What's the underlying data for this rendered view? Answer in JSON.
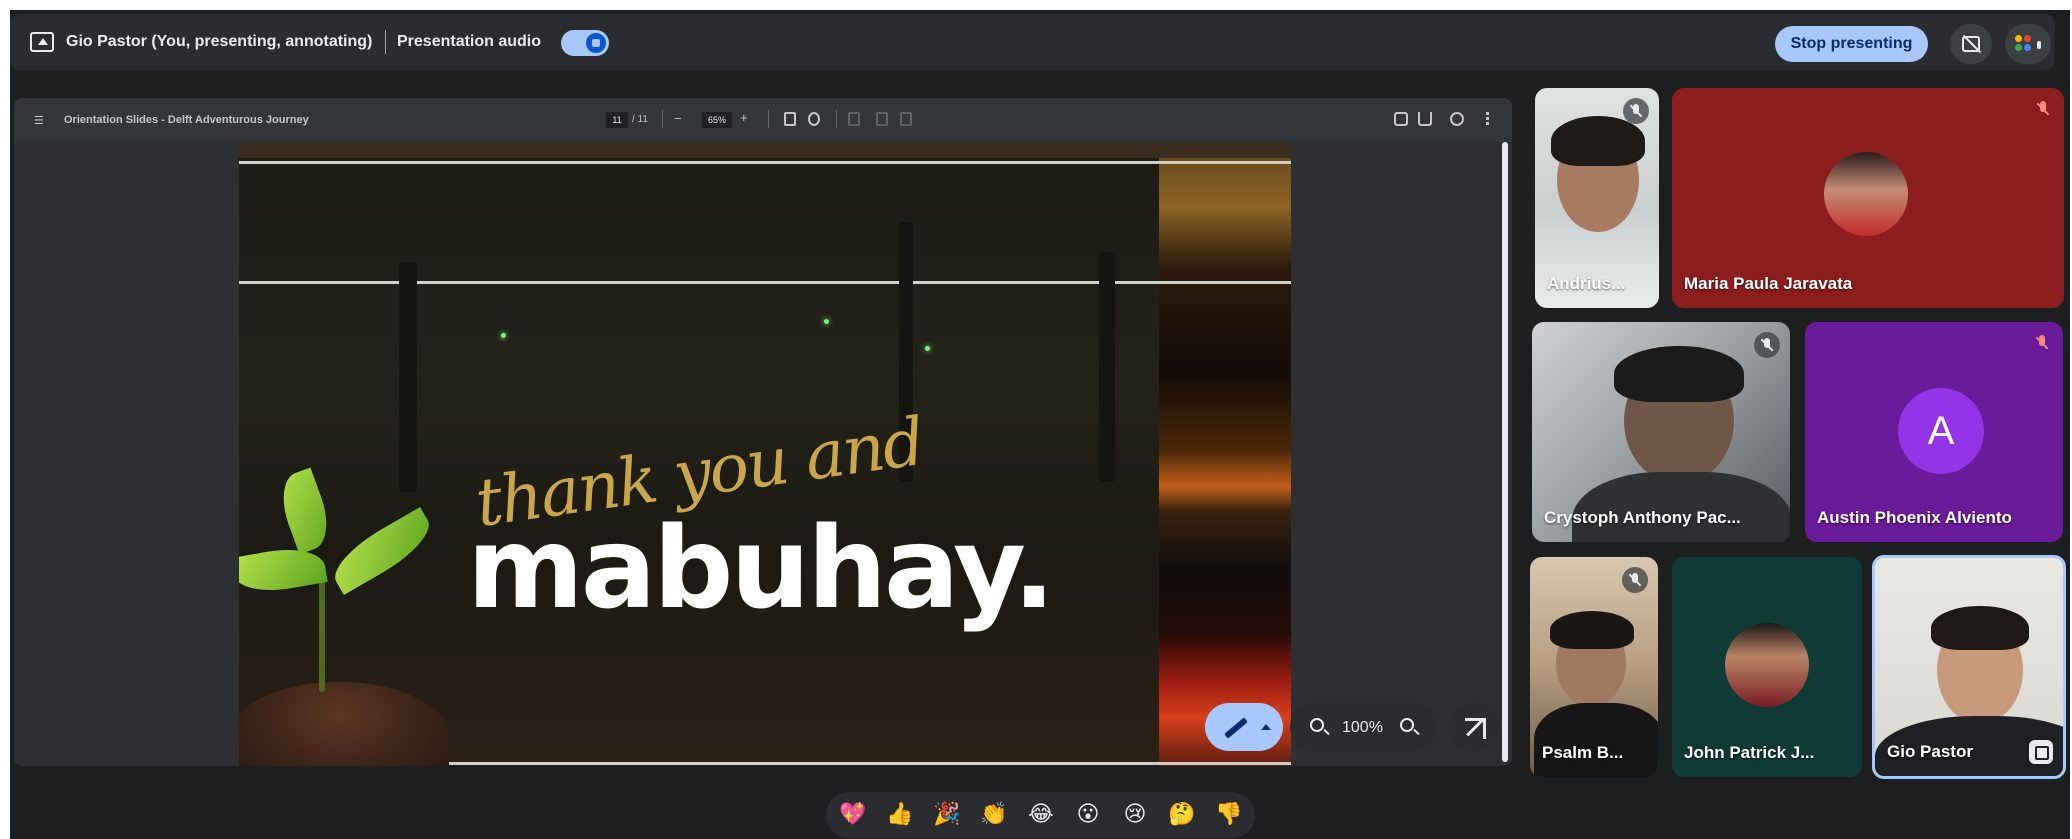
{
  "topbar": {
    "presenting_label": "Gio Pastor (You, presenting, annotating)",
    "audio_label": "Presentation audio",
    "audio_on": true,
    "stop_label": "Stop presenting",
    "accent": "#a8c7fa"
  },
  "viewer": {
    "menu_icon": "hamburger-icon",
    "title": "Orientation Slides - Delft Adventurous Journey",
    "page": "11",
    "page_total": "/ 11",
    "zoom": "65%",
    "minus": "−",
    "plus": "+"
  },
  "slide": {
    "script": "thank you and",
    "headline": "mabuhay."
  },
  "annotation": {
    "zoom_value": "100%"
  },
  "participants": [
    {
      "name": "Andrius...",
      "muted": true
    },
    {
      "name": "Maria Paula Jaravata",
      "muted": true,
      "tile_color": "#8c1d1d"
    },
    {
      "name": "Crystoph Anthony Pac...",
      "muted": true
    },
    {
      "name": "Austin Phoenix Alviento",
      "muted": true,
      "avatar_letter": "A",
      "tile_color": "#6a1b9a"
    },
    {
      "name": "Psalm B...",
      "muted": true
    },
    {
      "name": "John Patrick J...",
      "muted": false,
      "tile_color": "#0f3a36"
    },
    {
      "name": "Gio Pastor",
      "muted": false
    }
  ],
  "reactions": [
    "💖",
    "👍",
    "🎉",
    "👏",
    "😂",
    "😮",
    "😢",
    "🤔",
    "👎"
  ]
}
